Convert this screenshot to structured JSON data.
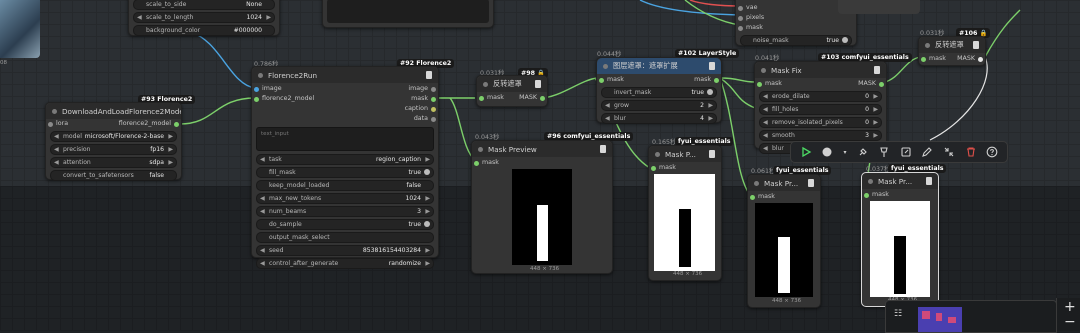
{
  "nodes": {
    "loader": {
      "badge": "#93 Florence2",
      "title": "DownloadAndLoadFlorence2Model",
      "inputs": [
        {
          "label": "lora"
        }
      ],
      "outputs": [
        {
          "label": "florence2_model"
        }
      ],
      "widgets": [
        {
          "name": "model",
          "value": "microsoft/Florence-2-base"
        },
        {
          "name": "precision",
          "value": "fp16"
        },
        {
          "name": "attention",
          "value": "sdpa"
        },
        {
          "name": "convert_to_safetensors",
          "value": "false"
        }
      ]
    },
    "run": {
      "time": "0.786秒",
      "badge": "#92 Florence2",
      "title": "Florence2Run",
      "inputs": [
        {
          "label": "image"
        },
        {
          "label": "florence2_model"
        }
      ],
      "outputs": [
        {
          "label": "image"
        },
        {
          "label": "mask"
        },
        {
          "label": "caption"
        },
        {
          "label": "data"
        }
      ],
      "text_placeholder": "text_input",
      "widgets": [
        {
          "name": "task",
          "value": "region_caption"
        },
        {
          "name": "fill_mask",
          "value": "true"
        },
        {
          "name": "keep_model_loaded",
          "value": "false"
        },
        {
          "name": "max_new_tokens",
          "value": "1024"
        },
        {
          "name": "num_beams",
          "value": "3"
        },
        {
          "name": "do_sample",
          "value": "true"
        },
        {
          "name": "output_mask_select",
          "value": ""
        },
        {
          "name": "seed",
          "value": "853816154403284"
        },
        {
          "name": "control_after_generate",
          "value": "randomize"
        }
      ]
    },
    "invert1": {
      "time": "0.031秒",
      "badge": "#98 🔒",
      "title": "反转遮罩",
      "input": "mask",
      "output": "MASK"
    },
    "preview96": {
      "time": "0.043秒",
      "badge": "#96 comfyui_essentials",
      "title": "Mask Preview",
      "input": "mask",
      "dims": "448 × 736"
    },
    "layerstyle": {
      "time": "0.044秒",
      "badge": "#102 LayerStyle",
      "title": "图层遮罩：遮罩扩展",
      "input": "mask",
      "output": "mask",
      "widgets": [
        {
          "name": "invert_mask",
          "value": "true"
        },
        {
          "name": "grow",
          "value": "2"
        },
        {
          "name": "blur",
          "value": "4"
        }
      ]
    },
    "preview_b": {
      "time": "0.165秒",
      "badge": "fyui_essentials",
      "title": "Mask P...",
      "input": "mask",
      "dims": "448 × 736"
    },
    "maskfix": {
      "time": "0.041秒",
      "badge": "#103 comfyui_essentials",
      "title": "Mask Fix",
      "input": "mask",
      "output": "MASK",
      "widgets": [
        {
          "name": "erode_dilate",
          "value": "0"
        },
        {
          "name": "fill_holes",
          "value": "0"
        },
        {
          "name": "remove_isolated_pixels",
          "value": "0"
        },
        {
          "name": "smooth",
          "value": "3"
        },
        {
          "name": "blur",
          "value": "0"
        }
      ]
    },
    "preview_c": {
      "time": "0.061秒",
      "badge": "fyui_essentials",
      "title": "Mask Pr...",
      "input": "mask",
      "dims": "448 × 736"
    },
    "preview_d": {
      "time": "0.037秒",
      "badge": "fyui_essentials",
      "title": "Mask Pr...",
      "input": "mask",
      "dims": "448 × 736"
    },
    "invert2": {
      "time": "0.031秒",
      "badge": "#106 🔒",
      "title": "反转遮罩",
      "input": "mask",
      "output": "MASK"
    },
    "top_left": {
      "widgets": [
        {
          "name": "scale_to_side",
          "value": "None"
        },
        {
          "name": "scale_to_length",
          "value": "1024"
        },
        {
          "name": "background_color",
          "value": "#000000"
        }
      ]
    },
    "top_right": {
      "inputs": [
        {
          "label": "vae"
        },
        {
          "label": "pixels"
        },
        {
          "label": "mask"
        }
      ],
      "widgets": [
        {
          "name": "noise_mask",
          "value": "true"
        }
      ]
    },
    "corner_text": "08"
  },
  "toolbar": {
    "icons": [
      "play-icon",
      "color-icon",
      "pin-icon",
      "bypass-icon",
      "edit-icon",
      "pencil-icon",
      "collapse-icon",
      "delete-icon",
      "help-icon"
    ]
  },
  "colors": {
    "wire_green": "#7ccf6a",
    "wire_blue": "#4aa3e0",
    "wire_red": "#e05050",
    "badge_bg": "#1a1a1a",
    "delete_red": "#e0504a",
    "play_green": "#4cd964"
  }
}
